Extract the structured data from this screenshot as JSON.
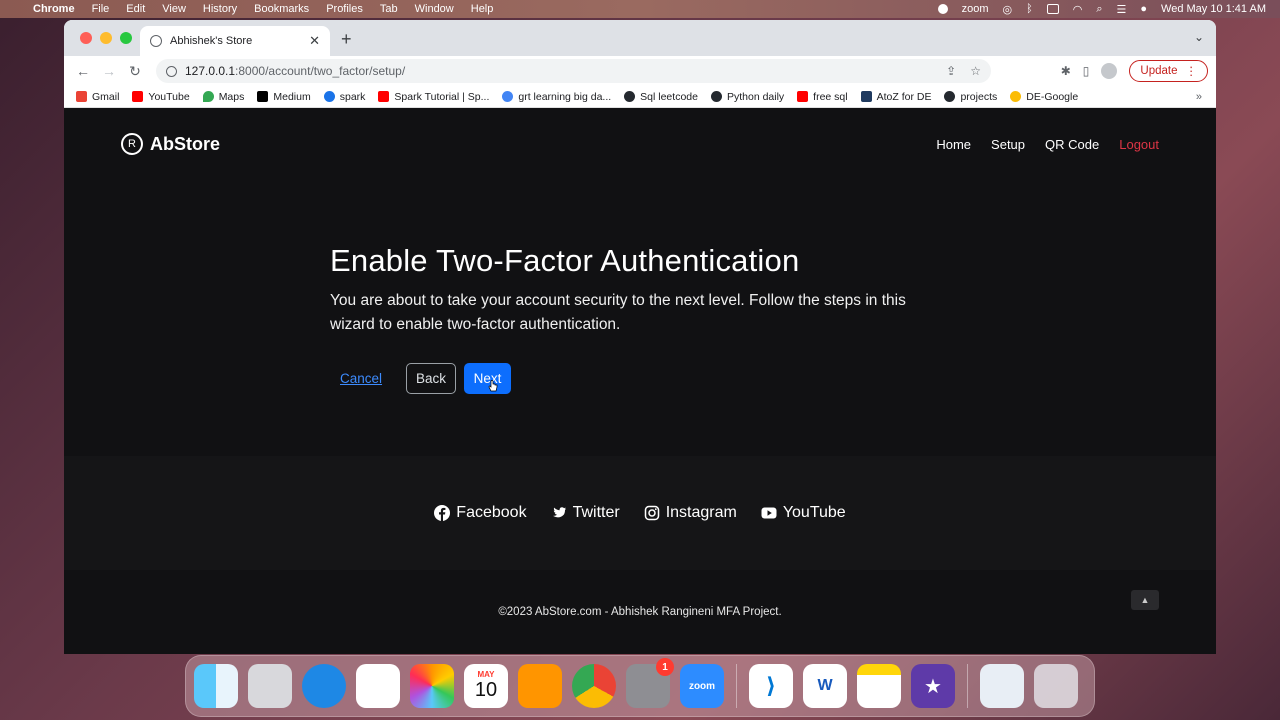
{
  "menubar": {
    "app_name": "Chrome",
    "menus": [
      "File",
      "Edit",
      "View",
      "History",
      "Bookmarks",
      "Profiles",
      "Tab",
      "Window",
      "Help"
    ],
    "zoom_label": "zoom",
    "datetime": "Wed May 10  1:41 AM"
  },
  "browser": {
    "tab_title": "Abhishek's Store",
    "url_host": "127.0.0.1",
    "url_path": ":8000/account/two_factor/setup/",
    "update_label": "Update",
    "bookmarks": [
      {
        "label": "Gmail",
        "color": "#ea4335"
      },
      {
        "label": "YouTube",
        "color": "#ff0000"
      },
      {
        "label": "Maps",
        "color": "#34a853"
      },
      {
        "label": "Medium",
        "color": "#000000"
      },
      {
        "label": "spark",
        "color": "#1a73e8"
      },
      {
        "label": "Spark Tutorial | Sp...",
        "color": "#ff0000"
      },
      {
        "label": "grt learning big da...",
        "color": "#4285f4"
      },
      {
        "label": "Sql leetcode",
        "color": "#24292f"
      },
      {
        "label": "Python daily",
        "color": "#24292f"
      },
      {
        "label": "free sql",
        "color": "#ff0000"
      },
      {
        "label": "AtoZ for DE",
        "color": "#1f3a5f"
      },
      {
        "label": "projects",
        "color": "#24292f"
      },
      {
        "label": "DE-Google",
        "color": "#fbbc04"
      }
    ]
  },
  "site": {
    "brand": "AbStore",
    "brand_logo_letter": "R",
    "nav": {
      "home": "Home",
      "setup": "Setup",
      "qr": "QR Code",
      "logout": "Logout"
    },
    "heading": "Enable Two-Factor Authentication",
    "description": "You are about to take your account security to the next level. Follow the steps in this wizard to enable two-factor authentication.",
    "cancel_label": "Cancel",
    "back_label": "Back",
    "next_label": "Next",
    "social": {
      "facebook": "Facebook",
      "twitter": "Twitter",
      "instagram": "Instagram",
      "youtube": "YouTube"
    },
    "footer": "©2023 AbStore.com - Abhishek Rangineni MFA Project.",
    "colors": {
      "primary": "#0d6efd",
      "logout": "#dc3545",
      "bg": "#111113"
    }
  },
  "dock": {
    "calendar_month": "MAY",
    "calendar_day": "10",
    "settings_badge": "1",
    "zoom_label": "zoom",
    "word_letter": "W"
  }
}
